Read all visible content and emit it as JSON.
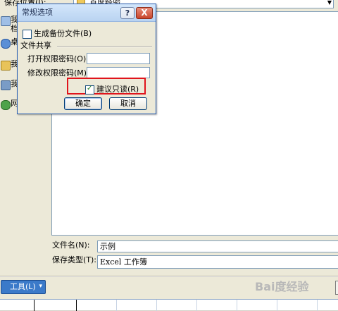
{
  "save_dialog": {
    "save_in_label": "保存位置(I):",
    "save_in_value": "百度经验",
    "places": [
      {
        "label": "我\n档",
        "icon": "my-recent-documents-icon"
      },
      {
        "label": "桌",
        "icon": "desktop-icon"
      },
      {
        "label": "我",
        "icon": "my-documents-icon"
      },
      {
        "label": "我",
        "icon": "my-computer-icon"
      },
      {
        "label": "网",
        "icon": "network-places-icon"
      }
    ],
    "file_name_label": "文件名(N):",
    "file_name_value": "示例",
    "file_type_label": "保存类型(T):",
    "file_type_value": "Excel 工作簿",
    "tools_label": "工具(L)"
  },
  "options_dialog": {
    "title": "常规选项",
    "help_label": "?",
    "close_label": "X",
    "backup_label": "生成备份文件(B)",
    "backup_checked": false,
    "file_sharing_label": "文件共享",
    "open_password_label": "打开权限密码(O):",
    "modify_password_label": "修改权限密码(M):",
    "read_only_label": "建议只读(R)",
    "read_only_checked": true,
    "ok_label": "确定",
    "cancel_label": "取消",
    "highlight_color": "#e0141c"
  },
  "watermark": "Bai度经验"
}
